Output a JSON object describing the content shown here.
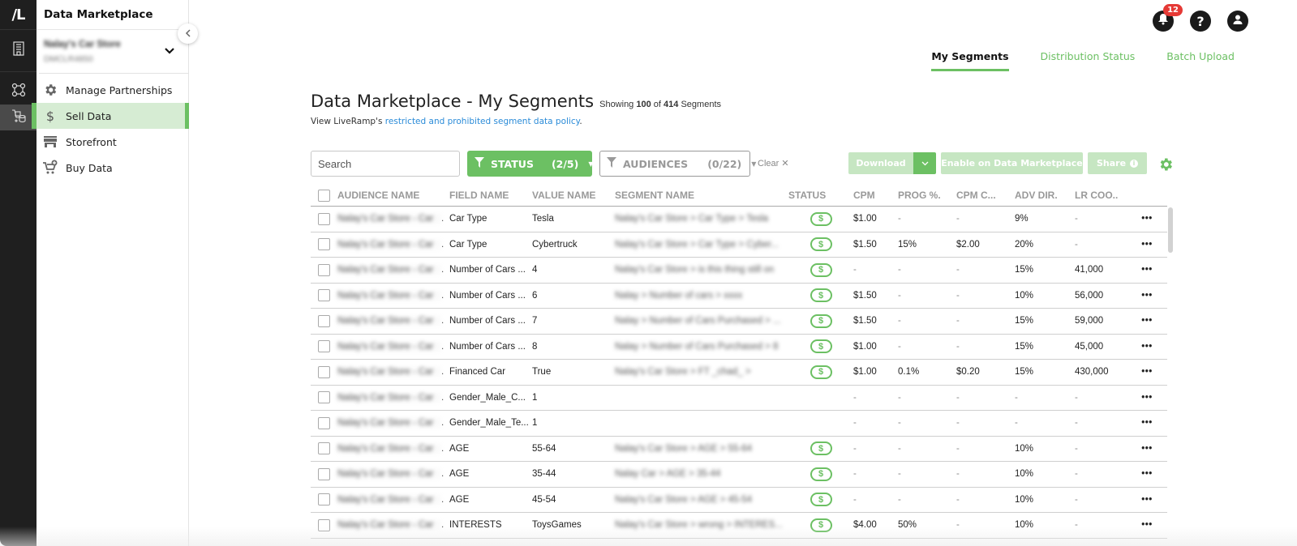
{
  "app": {
    "logo_text": "/L",
    "title": "Data Marketplace"
  },
  "rail": {
    "icons": [
      "building-icon",
      "partnerships-network-icon",
      "marketplace-cart-db-icon"
    ],
    "active": "marketplace-cart-db-icon"
  },
  "sidebar": {
    "org": {
      "name": "Nalay's Car Store",
      "id": "DMCLR4850"
    },
    "items": [
      {
        "label": "Manage Partnerships",
        "icon": "gear-icon"
      },
      {
        "label": "Sell Data",
        "icon": "dollar-icon",
        "active": true
      },
      {
        "label": "Storefront",
        "icon": "storefront-icon"
      },
      {
        "label": "Buy Data",
        "icon": "cart-add-icon"
      }
    ]
  },
  "topbar": {
    "notifications_count": "12",
    "tabs": [
      {
        "label": "My Segments",
        "active": true
      },
      {
        "label": "Distribution Status"
      },
      {
        "label": "Batch Upload"
      }
    ]
  },
  "page": {
    "title": "Data Marketplace - My Segments",
    "showing_prefix": "Showing",
    "showing_count": "100",
    "showing_of": "of",
    "showing_total": "414",
    "showing_suffix": "Segments",
    "policy_prefix": "View LiveRamp's",
    "policy_link": "restricted and prohibited segment data policy",
    "policy_suffix": "."
  },
  "toolbar": {
    "search_placeholder": "Search",
    "status_filter": {
      "label": "STATUS",
      "count": "(2/5)"
    },
    "audiences_filter": {
      "label": "AUDIENCES",
      "count": "(0/22)"
    },
    "clear_label": "Clear",
    "download_label": "Download",
    "enable_label": "Enable on Data Marketplace",
    "share_label": "Share"
  },
  "colors": {
    "accent": "#6cc063",
    "accent_light": "#c6e6c2",
    "active_nav_bg": "#d6ecd3",
    "link": "#2a8bd8",
    "badge": "#e53935",
    "rail_bg": "#1f1f1f"
  },
  "table": {
    "columns": [
      "AUDIENCE NAME",
      "FIELD NAME",
      "VALUE NAME",
      "SEGMENT NAME",
      "STATUS",
      "CPM",
      "PROG %.",
      "CPM C...",
      "ADV DIR.",
      "LR COO.."
    ],
    "rows": [
      {
        "audience": "Nalay's Car Store - Car",
        "field": "Car Type",
        "value": "Tesla",
        "segment": "Nalay's Car Store > Car Type > Tesla",
        "status": "$",
        "cpm": "$1.00",
        "prog": "-",
        "cpmc": "-",
        "adv": "9%",
        "lr": "-"
      },
      {
        "audience": "Nalay's Car Store - Car",
        "field": "Car Type",
        "value": "Cybertruck",
        "segment": "Nalay's Car Store > Car Type > Cyber...",
        "status": "$",
        "cpm": "$1.50",
        "prog": "15%",
        "cpmc": "$2.00",
        "adv": "20%",
        "lr": "-"
      },
      {
        "audience": "Nalay's Car Store - Car",
        "field": "Number of Cars ...",
        "value": "4",
        "segment": "Nalay's Car Store > is this thing still on",
        "status": "$",
        "cpm": "-",
        "prog": "-",
        "cpmc": "-",
        "adv": "15%",
        "lr": "41,000"
      },
      {
        "audience": "Nalay's Car Store - Car",
        "field": "Number of Cars ...",
        "value": "6",
        "segment": "Nalay > Number of cars > xxxx",
        "status": "$",
        "cpm": "$1.50",
        "prog": "-",
        "cpmc": "-",
        "adv": "10%",
        "lr": "56,000"
      },
      {
        "audience": "Nalay's Car Store - Car",
        "field": "Number of Cars ...",
        "value": "7",
        "segment": "Nalay > Number of Cars Purchased > ...",
        "status": "$",
        "cpm": "$1.50",
        "prog": "-",
        "cpmc": "-",
        "adv": "15%",
        "lr": "59,000"
      },
      {
        "audience": "Nalay's Car Store - Car",
        "field": "Number of Cars ...",
        "value": "8",
        "segment": "Nalay > Number of Cars Purchased > 8",
        "status": "$",
        "cpm": "$1.00",
        "prog": "-",
        "cpmc": "-",
        "adv": "15%",
        "lr": "45,000"
      },
      {
        "audience": "Nalay's Car Store - Car",
        "field": "Financed Car",
        "value": "True",
        "segment": "Nalay's Car Store > FT _chad_ >",
        "status": "$",
        "cpm": "$1.00",
        "prog": "0.1%",
        "cpmc": "$0.20",
        "adv": "15%",
        "lr": "430,000"
      },
      {
        "audience": "Nalay's Car Store - Car",
        "field": "Gender_Male_C...",
        "value": "1",
        "segment": "",
        "status": "",
        "cpm": "-",
        "prog": "-",
        "cpmc": "-",
        "adv": "-",
        "lr": "-"
      },
      {
        "audience": "Nalay's Car Store - Car",
        "field": "Gender_Male_Te...",
        "value": "1",
        "segment": "",
        "status": "",
        "cpm": "-",
        "prog": "-",
        "cpmc": "-",
        "adv": "-",
        "lr": "-"
      },
      {
        "audience": "Nalay's Car Store - Car",
        "field": "AGE",
        "value": "55-64",
        "segment": "Nalay's Car Store > AGE > 55-64",
        "status": "$",
        "cpm": "-",
        "prog": "-",
        "cpmc": "-",
        "adv": "10%",
        "lr": "-"
      },
      {
        "audience": "Nalay's Car Store - Car",
        "field": "AGE",
        "value": "35-44",
        "segment": "Nalay Car > AGE > 35-44",
        "status": "$",
        "cpm": "-",
        "prog": "-",
        "cpmc": "-",
        "adv": "10%",
        "lr": "-"
      },
      {
        "audience": "Nalay's Car Store - Car",
        "field": "AGE",
        "value": "45-54",
        "segment": "Nalay's Car Store > AGE > 45-54",
        "status": "$",
        "cpm": "-",
        "prog": "-",
        "cpmc": "-",
        "adv": "10%",
        "lr": "-"
      },
      {
        "audience": "Nalay's Car Store - Car",
        "field": "INTERESTS",
        "value": "ToysGames",
        "segment": "Nalay's Car Store > wrong > INTERES...",
        "status": "$",
        "cpm": "$4.00",
        "prog": "50%",
        "cpmc": "-",
        "adv": "10%",
        "lr": "-"
      }
    ]
  }
}
